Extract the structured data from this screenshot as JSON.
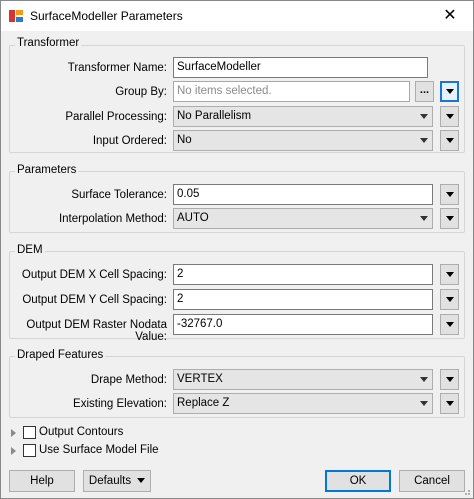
{
  "window": {
    "title": "SurfaceModeller Parameters",
    "close_glyph": "✕",
    "app_icon": "fme-transformer-icon"
  },
  "transformer": {
    "group_title": "Transformer",
    "name_label": "Transformer Name:",
    "name_value": "SurfaceModeller",
    "group_by_label": "Group By:",
    "group_by_placeholder": "No items selected.",
    "group_by_dots": "...",
    "parallel_label": "Parallel Processing:",
    "parallel_value": "No Parallelism",
    "input_ordered_label": "Input Ordered:",
    "input_ordered_value": "No"
  },
  "parameters": {
    "group_title": "Parameters",
    "tolerance_label": "Surface Tolerance:",
    "tolerance_value": "0.05",
    "interp_label": "Interpolation Method:",
    "interp_value": "AUTO"
  },
  "dem": {
    "group_title": "DEM",
    "x_label": "Output DEM X Cell Spacing:",
    "x_value": "2",
    "y_label": "Output DEM Y Cell Spacing:",
    "y_value": "2",
    "nodata_label": "Output DEM Raster Nodata Value:",
    "nodata_value": "-32767.0"
  },
  "draped": {
    "group_title": "Draped Features",
    "method_label": "Drape Method:",
    "method_value": "VERTEX",
    "elev_label": "Existing Elevation:",
    "elev_value": "Replace Z"
  },
  "options": {
    "contours_label": "Output Contours",
    "surface_file_label": "Use Surface Model File"
  },
  "buttons": {
    "help": "Help",
    "defaults": "Defaults",
    "ok": "OK",
    "cancel": "Cancel"
  }
}
